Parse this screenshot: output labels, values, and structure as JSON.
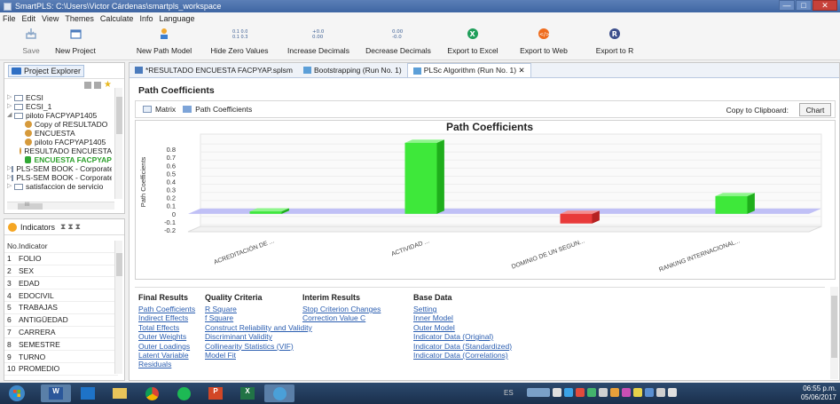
{
  "window": {
    "title": "SmartPLS: C:\\Users\\Victor Cárdenas\\smartpls_workspace",
    "controls": [
      "—",
      "□",
      "✕"
    ]
  },
  "menu": [
    "File",
    "Edit",
    "View",
    "Themes",
    "Calculate",
    "Info",
    "Language"
  ],
  "toolbar": {
    "save": "Save",
    "new_project": "New Project",
    "new_path_model": "New Path Model",
    "hide_zero_values": "Hide Zero Values",
    "increase_decimals": "Increase Decimals",
    "decrease_decimals": "Decrease Decimals",
    "export_excel": "Export to Excel",
    "export_web": "Export to Web",
    "export_r": "Export to R",
    "hide_zero_glyph": "0.1 0.0\n0.1 0.3",
    "increase_glyph": "+0.0\n0.00",
    "decrease_glyph": "0.00\n-0.0"
  },
  "project_explorer": {
    "tab_label": "Project Explorer",
    "items": [
      {
        "label": "ECSI",
        "type": "folder",
        "indent": 0,
        "exp": "▷"
      },
      {
        "label": "ECSI_1",
        "type": "folder",
        "indent": 0,
        "exp": "▷"
      },
      {
        "label": "piloto FACPYAP1405",
        "type": "folder",
        "indent": 0,
        "exp": "◢"
      },
      {
        "label": "Copy of RESULTADO",
        "type": "person",
        "indent": 1,
        "exp": ""
      },
      {
        "label": "ENCUESTA",
        "type": "person",
        "indent": 1,
        "exp": ""
      },
      {
        "label": "piloto FACPYAP1405",
        "type": "person",
        "indent": 1,
        "exp": ""
      },
      {
        "label": "RESULTADO ENCUESTA",
        "type": "person",
        "indent": 1,
        "exp": ""
      },
      {
        "label": "ENCUESTA FACPYAP",
        "type": "db",
        "indent": 1,
        "exp": ""
      },
      {
        "label": "PLS-SEM BOOK - Corporate",
        "type": "folder",
        "indent": 0,
        "exp": "▷"
      },
      {
        "label": "PLS-SEM BOOK - Corporate",
        "type": "folder",
        "indent": 0,
        "exp": "▷"
      },
      {
        "label": "satisfaccion de servicio",
        "type": "folder",
        "indent": 0,
        "exp": "▷"
      }
    ],
    "scroll_label": "III"
  },
  "indicators": {
    "tab_label": "Indicators",
    "columns": [
      "No.",
      "Indicator"
    ],
    "rows": [
      {
        "no": "1",
        "name": "FOLIO"
      },
      {
        "no": "2",
        "name": "SEX"
      },
      {
        "no": "3",
        "name": "EDAD"
      },
      {
        "no": "4",
        "name": "EDOCIVIL"
      },
      {
        "no": "5",
        "name": "TRABAJAS"
      },
      {
        "no": "6",
        "name": "ANTIGÜEDAD"
      },
      {
        "no": "7",
        "name": "CARRERA"
      },
      {
        "no": "8",
        "name": "SEMESTRE"
      },
      {
        "no": "9",
        "name": "TURNO"
      },
      {
        "no": "10",
        "name": "PROMEDIO"
      }
    ]
  },
  "editor_tabs": [
    {
      "label": "*RESULTADO ENCUESTA FACPYAP.splsm",
      "active": false
    },
    {
      "label": "Bootstrapping (Run No. 1)",
      "active": false
    },
    {
      "label": "PLSc Algorithm (Run No. 1) ✕",
      "active": true
    }
  ],
  "section_title": "Path Coefficients",
  "subtabs": {
    "matrix": "Matrix",
    "path_coefficients": "Path Coefficients",
    "copy_label": "Copy to Clipboard:",
    "chart_button": "Chart"
  },
  "chart_data": {
    "type": "bar",
    "title": "Path Coefficients",
    "ylabel": "Path Coefficients",
    "categories": [
      "ACREDITACIÓN DE ...",
      "ACTIVIDAD ...",
      "DOMINIO DE UN SEGUN...",
      "RANKING INTERNACIONAL..."
    ],
    "values": [
      0.03,
      0.88,
      -0.12,
      0.22
    ],
    "ylim": [
      -0.2,
      0.9
    ],
    "yticks": [
      0.8,
      0.7,
      0.6,
      0.5,
      0.4,
      0.3,
      0.2,
      0.1,
      0,
      -0.1,
      -0.2
    ],
    "positive_color": "#3ee83a",
    "negative_color": "#e83a3a",
    "zero_band_color": "#b9b9f5"
  },
  "results": {
    "final": {
      "header": "Final Results",
      "links": [
        "Path Coefficients",
        "Indirect Effects",
        "Total Effects",
        "Outer Weights",
        "Outer Loadings",
        "Latent Variable",
        "Residuals"
      ]
    },
    "quality": {
      "header": "Quality Criteria",
      "links": [
        "R Square",
        "f Square",
        "Construct Reliability and Validity",
        "Discriminant Validity",
        "Collinearity Statistics (VIF)",
        "Model Fit"
      ]
    },
    "interim": {
      "header": "Interim Results",
      "links": [
        "Stop Criterion Changes",
        "Correction Value C"
      ]
    },
    "base": {
      "header": "Base Data",
      "links": [
        "Setting",
        "Inner Model",
        "Outer Model",
        "Indicator Data (Original)",
        "Indicator Data (Standardized)",
        "Indicator Data (Correlations)"
      ]
    }
  },
  "taskbar": {
    "lang": "ES",
    "time": "06:55 p.m.",
    "date": "05/06/2017"
  }
}
